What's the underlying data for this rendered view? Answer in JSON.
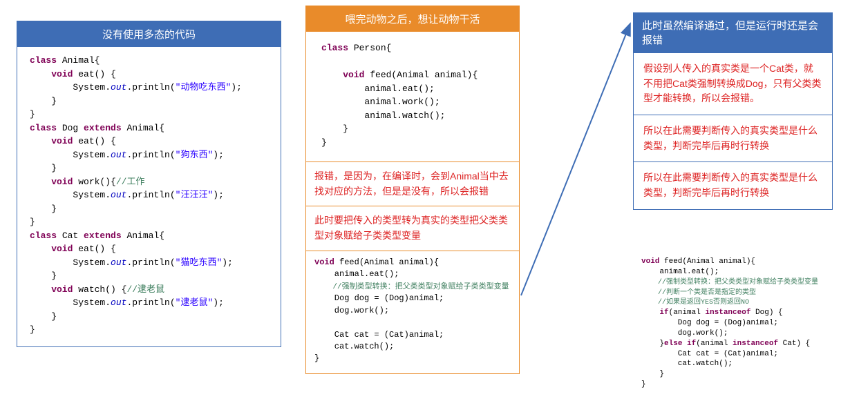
{
  "panel1": {
    "title": "没有使用多态的代码",
    "code": {
      "l1a": "class",
      "l1b": " Animal{",
      "l2a": "    void",
      "l2b": " eat() {",
      "l3a": "        System.",
      "l3out": "out",
      "l3b": ".println(",
      "l3s": "\"动物吃东西\"",
      "l3c": ");",
      "l4": "    }",
      "l5": "}",
      "l6a": "class",
      "l6b": " Dog ",
      "l6c": "extends",
      "l6d": " Animal{",
      "l7a": "    void",
      "l7b": " eat() {",
      "l8a": "        System.",
      "l8out": "out",
      "l8b": ".println(",
      "l8s": "\"狗东西\"",
      "l8c": ");",
      "l9": "    }",
      "l10a": "    void",
      "l10b": " work(){",
      "l10c": "//工作",
      "l11a": "        System.",
      "l11out": "out",
      "l11b": ".println(",
      "l11s": "\"汪汪汪\"",
      "l11c": ");",
      "l12": "    }",
      "l13": "}",
      "l14a": "class",
      "l14b": " Cat ",
      "l14c": "extends",
      "l14d": " Animal{",
      "l15a": "    void",
      "l15b": " eat() {",
      "l16a": "        System.",
      "l16out": "out",
      "l16b": ".println(",
      "l16s": "\"猫吃东西\"",
      "l16c": ");",
      "l17": "    }",
      "l18a": "    void",
      "l18b": " watch() {",
      "l18c": "//逮老鼠",
      "l19a": "        System.",
      "l19out": "out",
      "l19b": ".println(",
      "l19s": "\"逮老鼠\"",
      "l19c": ");",
      "l20": "    }",
      "l21": "}"
    }
  },
  "panel2": {
    "title": "喂完动物之后，想让动物干活",
    "code1": {
      "l1a": "class",
      "l1b": " Person{",
      "l2": "",
      "l3a": "    void",
      "l3b": " feed(Animal animal){",
      "l4": "        animal.eat();",
      "l5": "        animal.work();",
      "l6": "        animal.watch();",
      "l7": "    }",
      "l8": "}"
    },
    "note1": "报错，是因为，在编译时，会到Animal当中去找对应的方法，但是是没有，所以会报错",
    "note2": "此时要把传入的类型转为真实的类型把父类类型对象赋给子类类型变量",
    "code2": {
      "l1a": "void",
      "l1b": " feed(Animal animal){",
      "l2": "    animal.eat();",
      "l3": "    //强制类型转换：把父类类型对象赋给子类类型变量",
      "l4": "    Dog dog = (Dog)animal;",
      "l5": "    dog.work();",
      "l6": "",
      "l7": "    Cat cat = (Cat)animal;",
      "l8": "    cat.watch();",
      "l9": "}"
    }
  },
  "panel3": {
    "title": "此时虽然编译通过，但是运行时还是会报错",
    "note1": "假设别人传入的真实类是一个Cat类，就不用把Cat类强制转换成Dog，只有父类类型才能转换，所以会报错。",
    "note2": "所以在此需要判断传入的真实类型是什么类型，判断完毕后再时行转换",
    "note3": "所以在此需要判断传入的真实类型是什么类型，判断完毕后再时行转换",
    "code": {
      "l1a": "void",
      "l1b": " feed(Animal animal){",
      "l2": "    animal.eat();",
      "l3": "    //强制类型转换：把父类类型对象赋给子类类型变量",
      "l4": "    //判断一个类是否是指定的类型",
      "l5": "    //如果是返回YES否则返回NO",
      "l6a": "    if",
      "l6b": "(animal ",
      "l6c": "instanceof",
      "l6d": " Dog) {",
      "l7": "        Dog dog = (Dog)animal;",
      "l8": "        dog.work();",
      "l9a": "    }",
      "l9b": "else if",
      "l9c": "(animal ",
      "l9d": "instanceof",
      "l9e": " Cat) {",
      "l10": "        Cat cat = (Cat)animal;",
      "l11": "        cat.watch();",
      "l12": "    }",
      "l13": "}"
    }
  }
}
